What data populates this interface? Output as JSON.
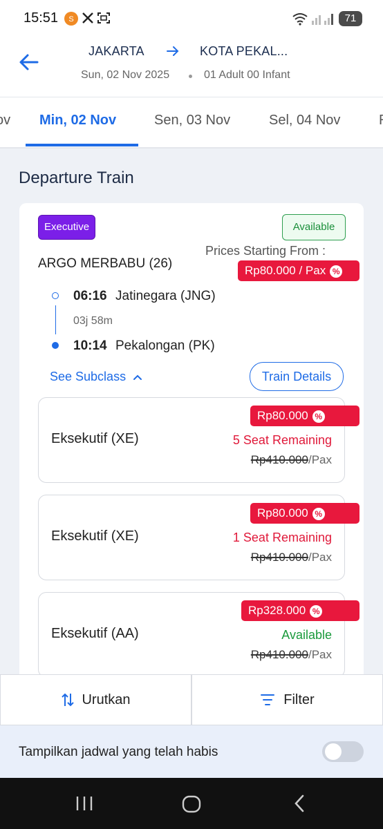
{
  "status_bar": {
    "time": "15:51",
    "battery": "71"
  },
  "header": {
    "origin": "JAKARTA",
    "destination": "KOTA PEKAL...",
    "date": "Sun, 02 Nov 2025",
    "passengers": "01 Adult 00 Infant"
  },
  "date_tabs": [
    {
      "label": "ov"
    },
    {
      "label": "Min, 02 Nov"
    },
    {
      "label": "Sen, 03 Nov"
    },
    {
      "label": "Sel, 04 Nov"
    },
    {
      "label": "R"
    }
  ],
  "section_title": "Departure Train",
  "train": {
    "class_badge": "Executive",
    "availability": "Available",
    "prices_label": "Prices Starting From :",
    "name": "ARGO MERBABU (26)",
    "price_tag": "Rp80.000 / Pax",
    "depart_time": "06:16",
    "depart_station": "Jatinegara (JNG)",
    "duration": "03j 58m",
    "arrive_time": "10:14",
    "arrive_station": "Pekalongan (PK)",
    "see_subclass": "See Subclass",
    "details_button": "Train Details"
  },
  "subclasses": [
    {
      "name": "Eksekutif (XE)",
      "price": "Rp80.000",
      "status": "5 Seat Remaining",
      "status_color": "#e0193a",
      "original_price": "Rp410.000",
      "unit": "/Pax"
    },
    {
      "name": "Eksekutif (XE)",
      "price": "Rp80.000",
      "status": "1 Seat Remaining",
      "status_color": "#e0193a",
      "original_price": "Rp410.000",
      "unit": "/Pax"
    },
    {
      "name": "Eksekutif (AA)",
      "price": "Rp328.000",
      "status": "Available",
      "status_color": "#1a9a3c",
      "original_price": "Rp410.000",
      "unit": "/Pax"
    }
  ],
  "bottom": {
    "sort_label": "Urutkan",
    "filter_label": "Filter",
    "toggle_label": "Tampilkan jadwal yang telah habis",
    "toggle_on": false
  },
  "colors": {
    "accent": "#1e6be6",
    "red": "#e8183d",
    "purple": "#7b1fe8",
    "green": "#1a8f3a"
  },
  "icons": [
    "back-arrow-icon",
    "route-arrow-icon",
    "chevron-up-icon",
    "discount-icon",
    "sort-icon",
    "filter-icon",
    "recent-apps-icon",
    "home-icon",
    "back-nav-icon"
  ]
}
